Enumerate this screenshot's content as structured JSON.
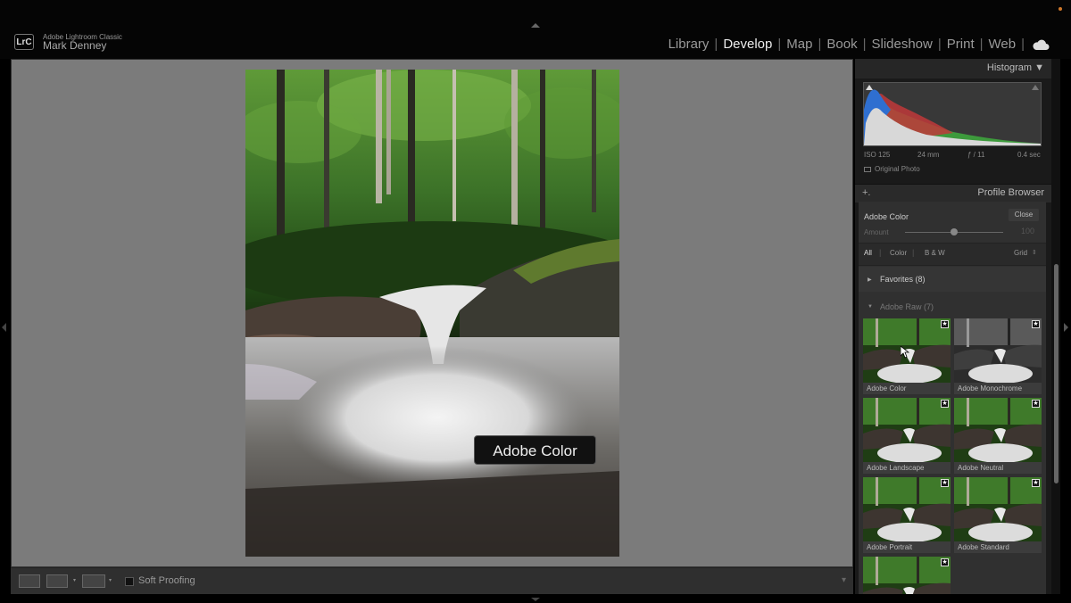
{
  "app": {
    "logo": "LrC",
    "name": "Adobe Lightroom Classic",
    "user": "Mark Denney"
  },
  "modules": [
    {
      "label": "Library",
      "active": false
    },
    {
      "label": "Develop",
      "active": true
    },
    {
      "label": "Map",
      "active": false
    },
    {
      "label": "Book",
      "active": false
    },
    {
      "label": "Slideshow",
      "active": false
    },
    {
      "label": "Print",
      "active": false
    },
    {
      "label": "Web",
      "active": false
    }
  ],
  "tooltip": "Adobe Color",
  "toolbar": {
    "soft_proofing": "Soft Proofing"
  },
  "histogram": {
    "title": "Histogram",
    "iso": "ISO 125",
    "focal": "24 mm",
    "aperture": "ƒ / 11",
    "shutter": "0.4 sec",
    "original_photo": "Original Photo"
  },
  "profile_browser": {
    "add": "+.",
    "title": "Profile Browser",
    "selected": "Adobe Color",
    "close": "Close",
    "amount_label": "Amount",
    "amount_value": "100",
    "amount_fraction": 0.5,
    "filters": [
      "All",
      "Color",
      "B & W"
    ],
    "view": "Grid",
    "favorites": "Favorites (8)",
    "group": "Adobe Raw (7)",
    "profiles": [
      {
        "label": "Adobe Color",
        "mono": false
      },
      {
        "label": "Adobe Monochrome",
        "mono": true
      },
      {
        "label": "Adobe Landscape",
        "mono": false
      },
      {
        "label": "Adobe Neutral",
        "mono": false
      },
      {
        "label": "Adobe Portrait",
        "mono": false
      },
      {
        "label": "Adobe Standard",
        "mono": false
      },
      {
        "label": "",
        "mono": false
      }
    ]
  },
  "colors": {
    "panel": "#1a1a1a",
    "canvas": "#7b7b7b",
    "accent_dot": "#d0782a"
  }
}
